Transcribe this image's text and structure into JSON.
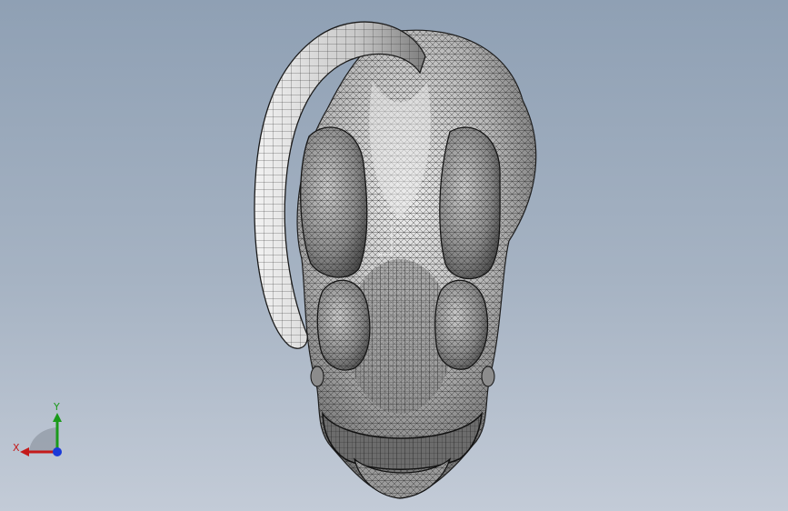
{
  "viewport": {
    "background_top": "#8fa0b4",
    "background_bottom": "#c3cbd7",
    "model": "mesh-model"
  },
  "triad": {
    "y_label": "Y",
    "x_label": "X",
    "colors": {
      "x": "#c41a1a",
      "y": "#1a9a1a",
      "z": "#1a3ad8"
    }
  },
  "colors": {
    "mesh_fill": "#d8d8d8",
    "mesh_shadow": "#7a7a7a",
    "mesh_line": "#1e1e1e"
  }
}
